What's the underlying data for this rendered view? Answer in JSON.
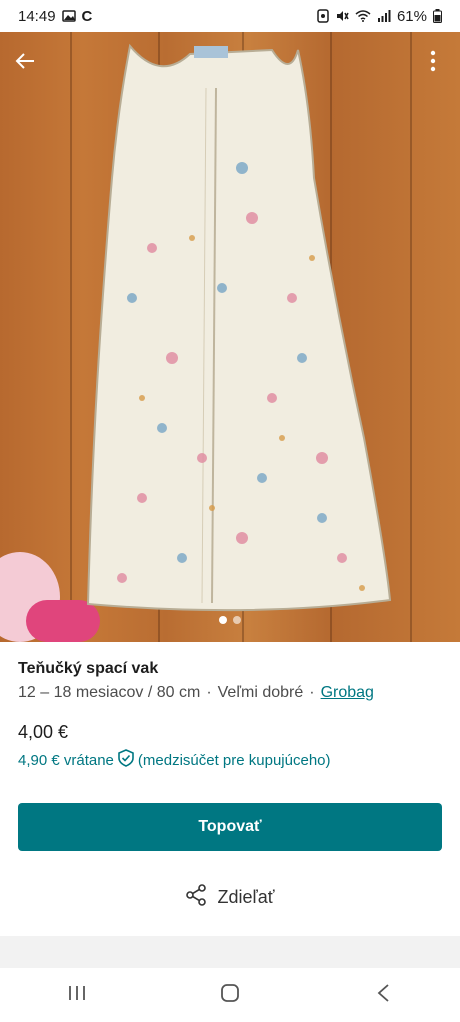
{
  "status_bar": {
    "time": "14:49",
    "left_icons": [
      "gallery-icon",
      "c-app-icon"
    ],
    "battery": "61%",
    "right_icons": [
      "nfc-icon",
      "mute-icon",
      "wifi-icon",
      "signal-icon",
      "battery-icon"
    ]
  },
  "photo": {
    "back_icon": "arrow-left-icon",
    "more_icon": "more-vertical-icon",
    "page_count": 2,
    "current_page": 1
  },
  "item": {
    "title": "Teňučký spací vak",
    "size": "12 – 18 mesiacov / 80 cm",
    "separator": "·",
    "condition": "Veľmi dobré",
    "brand": "Grobag",
    "price": "4,00 €",
    "buyer_price": "4,90 € vrátane",
    "buyer_note": "(medzisúčet pre kupujúceho)"
  },
  "actions": {
    "bump_label": "Topovať",
    "share_label": "Zdieľať"
  },
  "colors": {
    "accent": "#007782"
  }
}
